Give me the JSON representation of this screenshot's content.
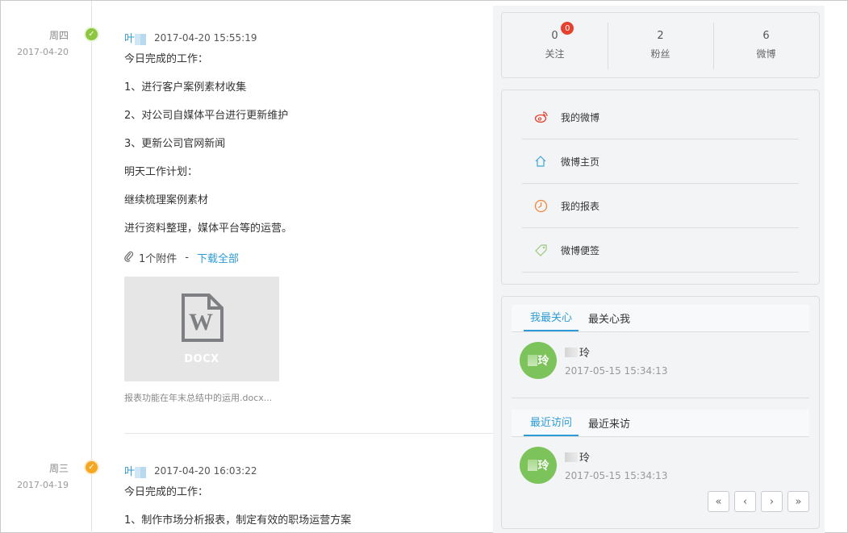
{
  "entries": [
    {
      "weekday": "周四",
      "date": "2017-04-20",
      "author": "叶",
      "timestamp": "2017-04-20 15:55:19",
      "lines": [
        "今日完成的工作：",
        "1、进行客户案例素材收集",
        "2、对公司自媒体平台进行更新维护",
        "3、更新公司官网新闻",
        "明天工作计划：",
        "继续梳理案例素材",
        "进行资料整理，媒体平台等的运营。"
      ],
      "attachment_count": "1个附件",
      "attachment_sep": "-",
      "download_all": "下载全部",
      "file_ext": "DOCX",
      "file_name": "报表功能在年末总结中的运用.docx..."
    },
    {
      "weekday": "周三",
      "date": "2017-04-19",
      "author": "叶",
      "timestamp": "2017-04-20 16:03:22",
      "lines": [
        "今日完成的工作：",
        "1、制作市场分析报表，制定有效的职场运营方案"
      ]
    }
  ],
  "stats": [
    {
      "value": "0",
      "label": "关注",
      "badge": "0"
    },
    {
      "value": "2",
      "label": "粉丝"
    },
    {
      "value": "6",
      "label": "微博"
    }
  ],
  "menu": [
    {
      "label": "我的微博",
      "icon": "weibo-icon"
    },
    {
      "label": "微博主页",
      "icon": "home-icon"
    },
    {
      "label": "我的报表",
      "icon": "clock-icon"
    },
    {
      "label": "微博便签",
      "icon": "tag-icon"
    }
  ],
  "follow": {
    "tabs1": [
      "我最关心",
      "最关心我"
    ],
    "user1": {
      "avatar_text": "玲",
      "name": "玲",
      "time": "2017-05-15 15:34:13"
    },
    "tabs2": [
      "最近访问",
      "最近来访"
    ],
    "user2": {
      "avatar_text": "玲",
      "name": "玲",
      "time": "2017-05-15 15:34:13"
    },
    "pager": [
      "«",
      "‹",
      "›",
      "»"
    ]
  },
  "colors": {
    "accent": "#2e9bd6",
    "badge": "#e6412e",
    "avatar": "#7dc35b"
  }
}
